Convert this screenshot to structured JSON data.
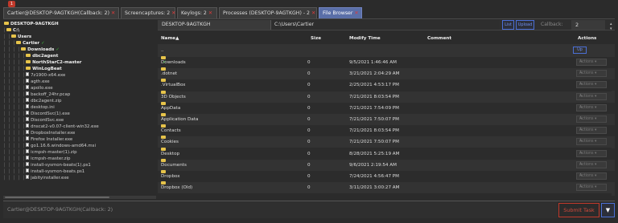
{
  "tabs": [
    {
      "label": "Cartier@DESKTOP-9AGTKGH(Callback: 2)",
      "close": "✕",
      "active": false
    },
    {
      "label": "Screencaptures: 2",
      "close": "✕",
      "active": false
    },
    {
      "label": "Keylogs: 2",
      "close": "✕",
      "active": false
    },
    {
      "label": "Processes (DESKTOP-9AGTKGH) - 2",
      "close": "✕",
      "active": false
    },
    {
      "label": "File Browser",
      "close": "✕",
      "active": true
    }
  ],
  "badge_count": "1",
  "tree": {
    "rows": [
      {
        "guides": "",
        "icon": "folder",
        "label": "DESKTOP-9AGTKGH",
        "bold": true,
        "check": false
      },
      {
        "guides": "│",
        "icon": "folder",
        "label": "C:\\",
        "bold": true,
        "check": false
      },
      {
        "guides": "│ │",
        "icon": "folder",
        "label": "Users",
        "bold": true,
        "check": false
      },
      {
        "guides": "│ │ │",
        "icon": "folder",
        "label": "Cartier",
        "bold": true,
        "check": true
      },
      {
        "guides": "│ │ │ │",
        "icon": "folder",
        "label": "Downloads",
        "bold": true,
        "check": true
      },
      {
        "guides": "│ │ │ │ │",
        "icon": "folder",
        "label": "dbc2agent",
        "bold": true,
        "check": false
      },
      {
        "guides": "│ │ │ │ │",
        "icon": "folder",
        "label": "NorthStarC2-master",
        "bold": true,
        "check": false
      },
      {
        "guides": "│ │ │ │ │",
        "icon": "folder",
        "label": "WinLogBeat",
        "bold": true,
        "check": false
      },
      {
        "guides": "│ │ │ │ │",
        "icon": "file",
        "label": "7z1900-x64.exe",
        "bold": false,
        "check": false
      },
      {
        "guides": "│ │ │ │ │",
        "icon": "file",
        "label": "agth.exe",
        "bold": false,
        "check": false
      },
      {
        "guides": "│ │ │ │ │",
        "icon": "file",
        "label": "apollo.exe",
        "bold": false,
        "check": false
      },
      {
        "guides": "│ │ │ │ │",
        "icon": "file",
        "label": "backoff_24hr.pcap",
        "bold": false,
        "check": false
      },
      {
        "guides": "│ │ │ │ │",
        "icon": "file",
        "label": "dbc2agent.zip",
        "bold": false,
        "check": false
      },
      {
        "guides": "│ │ │ │ │",
        "icon": "file",
        "label": "desktop.ini",
        "bold": false,
        "check": false
      },
      {
        "guides": "│ │ │ │ │",
        "icon": "file",
        "label": "DiscordSvc(1).exe",
        "bold": false,
        "check": false
      },
      {
        "guides": "│ │ │ │ │",
        "icon": "file",
        "label": "DiscordSvc.exe",
        "bold": false,
        "check": false
      },
      {
        "guides": "│ │ │ │ │",
        "icon": "file",
        "label": "dnscat2-v0.07-client-win32.exe",
        "bold": false,
        "check": false
      },
      {
        "guides": "│ │ │ │ │",
        "icon": "file",
        "label": "DropboxInstaller.exe",
        "bold": false,
        "check": false
      },
      {
        "guides": "│ │ │ │ │",
        "icon": "file",
        "label": "Firefox Installer.exe",
        "bold": false,
        "check": false
      },
      {
        "guides": "│ │ │ │ │",
        "icon": "file",
        "label": "go1.16.6.windows-amd64.msi",
        "bold": false,
        "check": false
      },
      {
        "guides": "│ │ │ │ │",
        "icon": "file",
        "label": "icmpsh-master(1).zip",
        "bold": false,
        "check": false
      },
      {
        "guides": "│ │ │ │ │",
        "icon": "file",
        "label": "icmpsh-master.zip",
        "bold": false,
        "check": false
      },
      {
        "guides": "│ │ │ │ │",
        "icon": "file",
        "label": "install-sysmon-beats(1).ps1",
        "bold": false,
        "check": false
      },
      {
        "guides": "│ │ │ │ │",
        "icon": "file",
        "label": "install-sysmon-beats.ps1",
        "bold": false,
        "check": false
      },
      {
        "guides": "│ │ │ │ │",
        "icon": "file",
        "label": "jabityinstaller.exe",
        "bold": false,
        "check": false
      }
    ]
  },
  "pathbar": {
    "host": "DESKTOP-9AGTKGH",
    "path": "C:\\Users\\Cartier",
    "list_label": "List",
    "upload_label": "Upload",
    "callback_label": "Callback:",
    "callback_value": "2"
  },
  "table": {
    "headers": {
      "name": "Name▲",
      "size": "Size",
      "modify": "Modify Time",
      "comment": "Comment",
      "actions": "Actions"
    },
    "parent_row": {
      "name": "..",
      "up_label": "Up"
    },
    "action_label": "Actions ▾",
    "rows": [
      {
        "name": "Downloads",
        "check": true,
        "size": "0",
        "modify": "9/5/2021 1:46:46 AM"
      },
      {
        "name": ".dotnet",
        "check": false,
        "size": "0",
        "modify": "3/21/2021 2:04:29 AM"
      },
      {
        "name": ".VirtualBox",
        "check": false,
        "size": "0",
        "modify": "2/25/2021 4:53:17 PM"
      },
      {
        "name": "3D Objects",
        "check": false,
        "size": "0",
        "modify": "7/21/2021 8:03:54 PM"
      },
      {
        "name": "AppData",
        "check": false,
        "size": "0",
        "modify": "7/21/2021 7:54:09 PM"
      },
      {
        "name": "Application Data",
        "check": false,
        "size": "0",
        "modify": "7/21/2021 7:50:07 PM"
      },
      {
        "name": "Contacts",
        "check": false,
        "size": "0",
        "modify": "7/21/2021 8:03:54 PM"
      },
      {
        "name": "Cookies",
        "check": false,
        "size": "0",
        "modify": "7/21/2021 7:50:07 PM"
      },
      {
        "name": "Desktop",
        "check": false,
        "size": "0",
        "modify": "8/28/2021 5:25:19 AM"
      },
      {
        "name": "Documents",
        "check": false,
        "size": "0",
        "modify": "9/6/2021 2:19:54 AM"
      },
      {
        "name": "Dropbox",
        "check": false,
        "size": "0",
        "modify": "7/24/2021 4:56:47 PM"
      },
      {
        "name": "Dropbox (Old)",
        "check": false,
        "size": "0",
        "modify": "3/11/2021 3:00:27 AM"
      }
    ]
  },
  "command": {
    "text": "Cartier@DESKTOP-9AGTKGH(Callback: 2)",
    "submit_label": "Submit Task",
    "filter_icon": "▼"
  }
}
